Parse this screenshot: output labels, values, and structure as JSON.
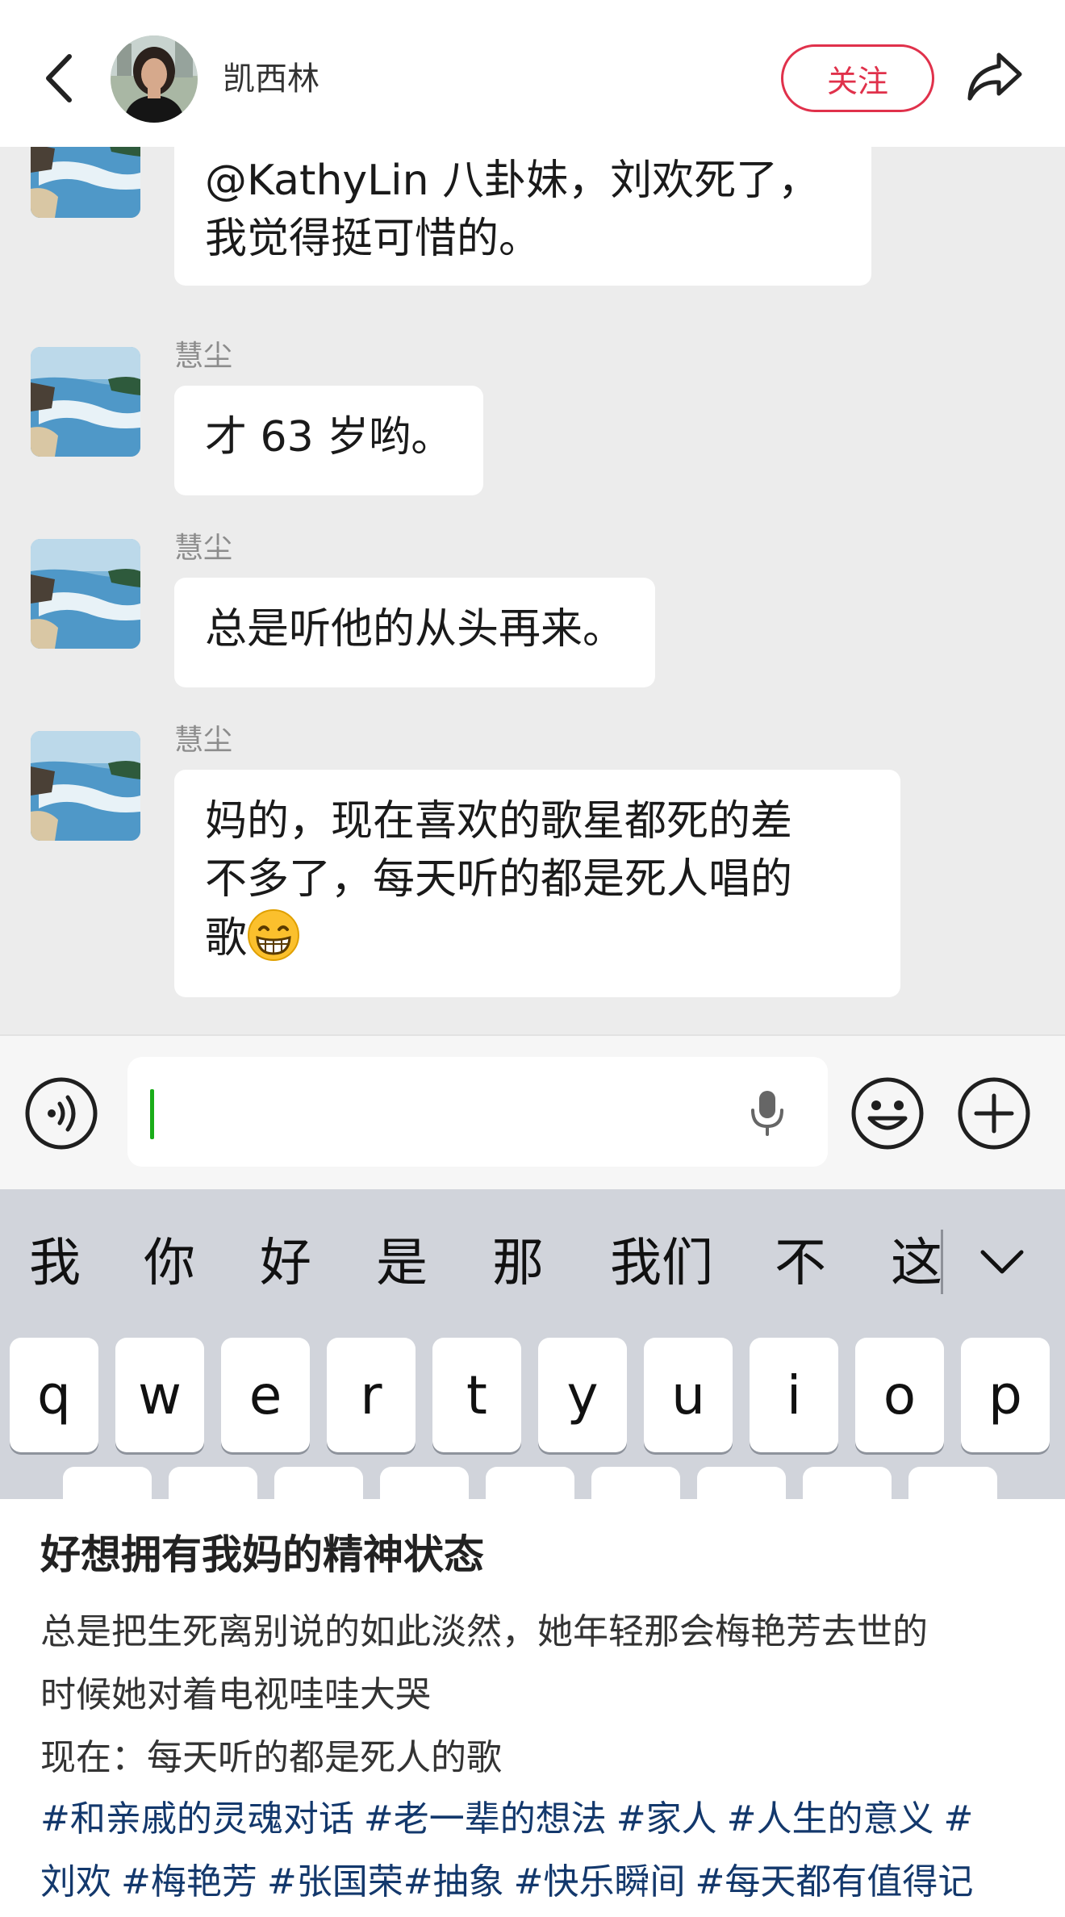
{
  "header": {
    "author_name": "凯西林",
    "follow_label": "关注"
  },
  "chat": {
    "messages": [
      {
        "sender": "",
        "text_lines": [
          "@KathyLin 八卦妹，刘欢死了，",
          "我觉得挺可惜的。"
        ]
      },
      {
        "sender": "慧尘",
        "text_lines": [
          "才 63 岁哟。"
        ]
      },
      {
        "sender": "慧尘",
        "text_lines": [
          "总是听他的从头再来。"
        ]
      },
      {
        "sender": "慧尘",
        "text_lines": [
          "妈的，现在喜欢的歌星都死的差",
          "不多了，每天听的都是死人唱的",
          "歌"
        ],
        "emoji": "grinning-face-icon"
      }
    ]
  },
  "input_bar": {
    "value": "",
    "icons": [
      "voice-icon",
      "microphone-icon",
      "emoji-icon",
      "plus-icon"
    ]
  },
  "keyboard": {
    "candidates": [
      "我",
      "你",
      "好",
      "是",
      "那",
      "我们",
      "不",
      "这"
    ],
    "expand_icon": "chevron-down-icon",
    "row1": [
      "q",
      "w",
      "e",
      "r",
      "t",
      "y",
      "u",
      "i",
      "o",
      "p"
    ]
  },
  "post": {
    "title": "好想拥有我妈的精神状态",
    "body_lines": [
      "总是把生死离别说的如此淡然，她年轻那会梅艳芳去世的",
      "时候她对着电视哇哇大哭",
      "现在：每天听的都是死人的歌"
    ],
    "tags": [
      "#和亲戚的灵魂对话",
      "#老一辈的想法",
      "#家人",
      "#人生的意义",
      "#",
      "刘欢",
      "#梅艳芳",
      "#张国荣#抽象",
      "#快乐瞬间",
      "#每天都有值得记"
    ]
  }
}
